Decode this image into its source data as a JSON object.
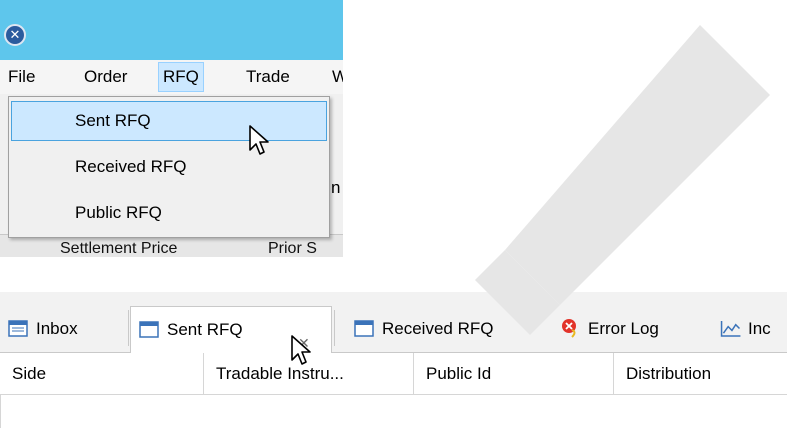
{
  "menubar": {
    "items": [
      "File",
      "Order",
      "RFQ",
      "Trade",
      "W"
    ]
  },
  "rfq_menu": {
    "items": [
      "Sent RFQ",
      "Received RFQ",
      "Public RFQ"
    ]
  },
  "background_columns": {
    "col1": "Settlement Price",
    "col2": "Prior S",
    "partial_label": "n"
  },
  "view_tabs": {
    "items": [
      {
        "label": "Inbox",
        "icon": "window-icon"
      },
      {
        "label": "Sent RFQ",
        "icon": "window-icon",
        "close": "✕"
      },
      {
        "label": "Received RFQ",
        "icon": "window-icon"
      },
      {
        "label": "Error Log",
        "icon": "error-log-icon"
      },
      {
        "label": "Inc",
        "icon": "chart-icon"
      }
    ]
  },
  "table": {
    "columns": [
      "Side",
      "Tradable Instru...",
      "Public Id",
      "Distribution"
    ]
  },
  "colors": {
    "titlebar": "#5ec6ec",
    "menu_highlight": "#cce8ff",
    "menu_highlight_border": "#4aa3df"
  }
}
